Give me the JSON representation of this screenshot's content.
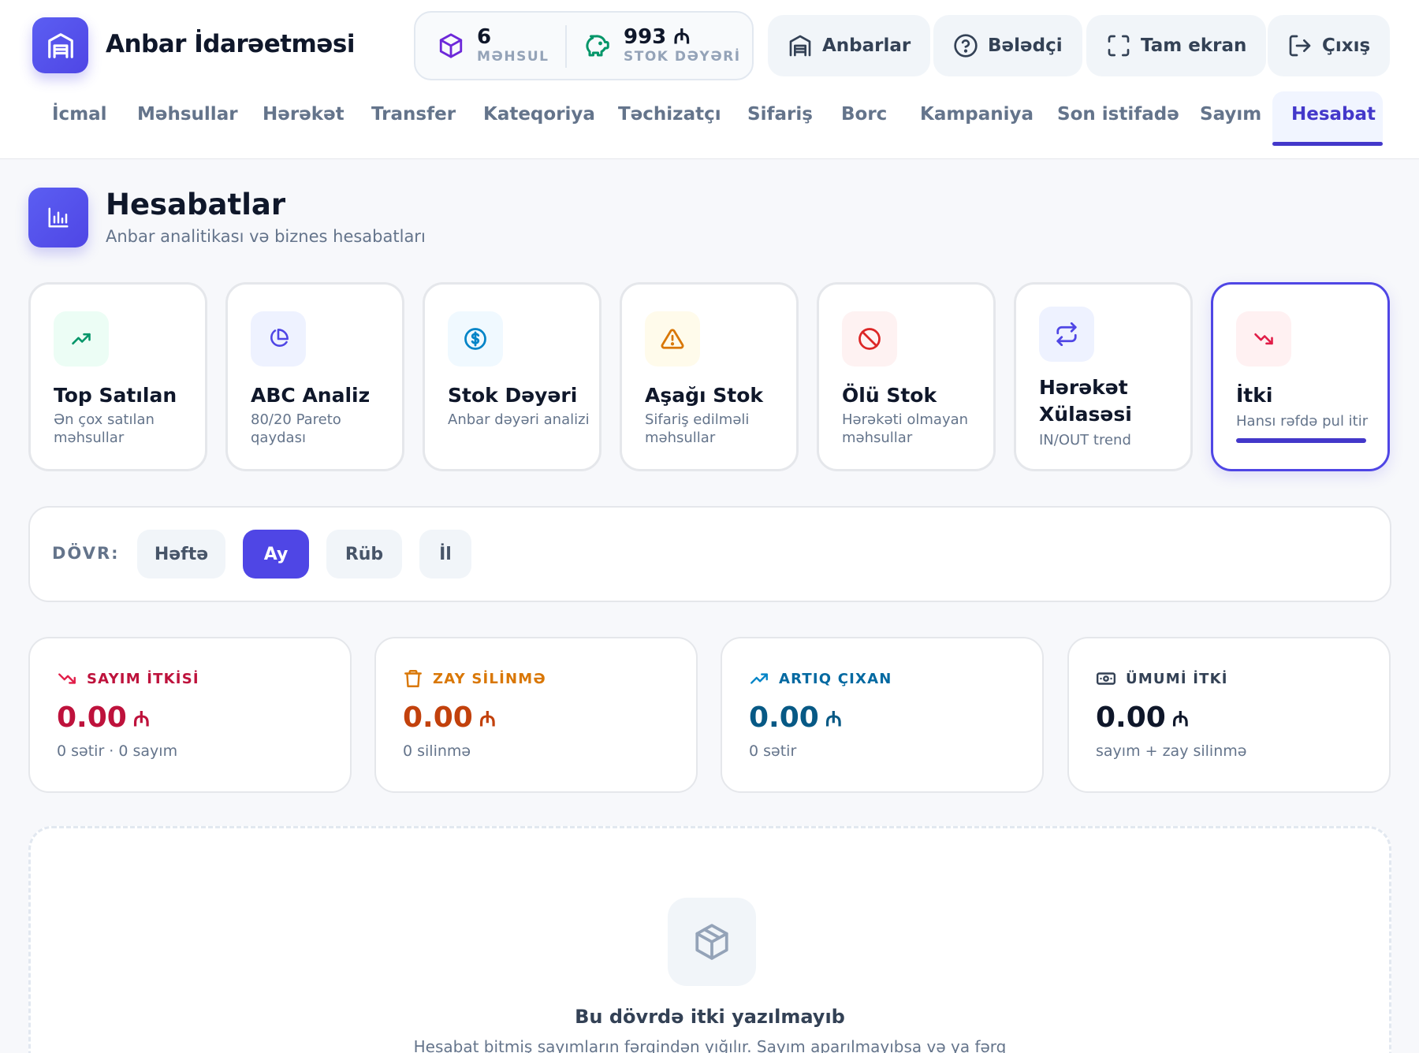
{
  "app": {
    "title": "Anbar İdarəetməsi"
  },
  "header_stats": {
    "products_count": "6",
    "products_label": "MƏHSUL",
    "stock_value": "993 ₼",
    "stock_value_label": "STOK DƏYƏRİ"
  },
  "header_buttons": {
    "warehouses": "Anbarlar",
    "guide": "Bələdçi",
    "fullscreen": "Tam ekran",
    "logout": "Çıxış"
  },
  "nav": {
    "tabs": [
      "İcmal",
      "Məhsullar",
      "Hərəkət",
      "Transfer",
      "Kateqoriya",
      "Təchizatçı",
      "Sifariş",
      "Borc",
      "Kampaniya",
      "Son istifadə",
      "Sayım",
      "Hesabat"
    ],
    "active": "Hesabat"
  },
  "page": {
    "title": "Hesabatlar",
    "subtitle": "Anbar analitikası və biznes hesabatları"
  },
  "reports": [
    {
      "title": "Top Satılan",
      "desc": "Ən çox satılan məhsullar",
      "icon": "trending-up-icon"
    },
    {
      "title": "ABC Analiz",
      "desc": "80/20 Pareto qaydası",
      "icon": "pie-chart-icon"
    },
    {
      "title": "Stok Dəyəri",
      "desc": "Anbar dəyəri analizi",
      "icon": "dollar-circle-icon"
    },
    {
      "title": "Aşağı Stok",
      "desc": "Sifariş edilməli məhsullar",
      "icon": "warning-icon"
    },
    {
      "title": "Ölü Stok",
      "desc": "Hərəkəti olmayan məhsullar",
      "icon": "ban-icon"
    },
    {
      "title": "Hərəkət Xülasəsi",
      "desc": "IN/OUT trend",
      "icon": "repeat-icon"
    },
    {
      "title": "İtki",
      "desc": "Hansı rəfdə pul itir",
      "icon": "trending-down-icon",
      "active": true
    }
  ],
  "period": {
    "label": "DÖVR:",
    "options": [
      "Həftə",
      "Ay",
      "Rüb",
      "İl"
    ],
    "selected": "Ay"
  },
  "metrics": [
    {
      "label": "SAYIM İTKİSİ",
      "value": "0.00",
      "currency": "₼",
      "sub": "0 sətir · 0 sayım",
      "color": "#be123c",
      "icon": "trending-down-icon"
    },
    {
      "label": "ZAY SİLİNMƏ",
      "value": "0.00",
      "currency": "₼",
      "sub": "0 silinmə",
      "color": "#c2410c",
      "icon": "trash-icon"
    },
    {
      "label": "ARTIQ ÇIXAN",
      "value": "0.00",
      "currency": "₼",
      "sub": "0 sətir",
      "color": "#075985",
      "icon": "trending-up-icon"
    },
    {
      "label": "ÜMUMİ İTKİ",
      "value": "0.00",
      "currency": "₼",
      "sub": "sayım + zay silinmə",
      "color": "#0f172a",
      "icon": "banknote-icon"
    }
  ],
  "empty_state": {
    "title": "Bu dövrdə itki yazılmayıb",
    "desc": "Hesabat bitmiş sayımların fərqindən yığılır. Sayım aparılmayıbsa və ya fərq",
    "icon": "box-icon"
  },
  "colors": {
    "accent": "#4f46e5",
    "accent_dark": "#4338ca",
    "loss": "#be123c",
    "waste": "#c2410c",
    "surplus": "#075985"
  }
}
